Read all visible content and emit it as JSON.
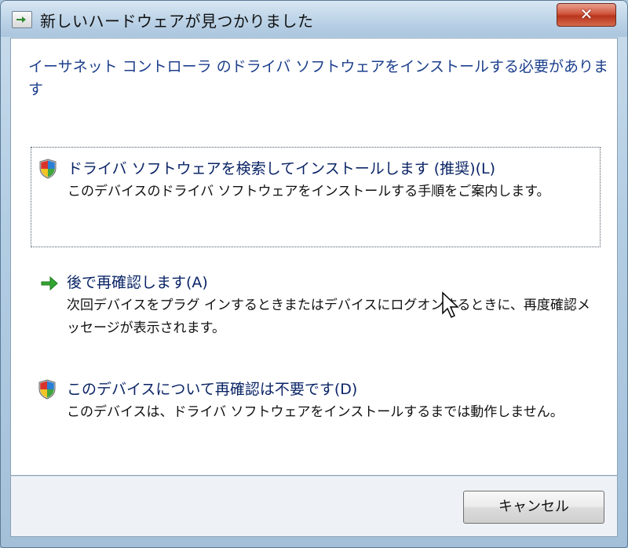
{
  "window": {
    "title": "新しいハードウェアが見つかりました",
    "close_label": "✕"
  },
  "header": {
    "text": "イーサネット コントローラ のドライバ ソフトウェアをインストールする必要があります"
  },
  "options": [
    {
      "title": "ドライバ ソフトウェアを検索してインストールします (推奨)(L)",
      "description": "このデバイスのドライバ ソフトウェアをインストールする手順をご案内します。",
      "icon": "shield-icon"
    },
    {
      "title": "後で再確認します(A)",
      "description": "次回デバイスをプラグ インするときまたはデバイスにログオンするときに、再度確認メッセージが表示されます。",
      "icon": "green-arrow-icon"
    },
    {
      "title": "このデバイスについて再確認は不要です(D)",
      "description": "このデバイスは、ドライバ ソフトウェアをインストールするまでは動作しません。",
      "icon": "shield-icon"
    }
  ],
  "footer": {
    "cancel_label": "キャンセル"
  },
  "colors": {
    "header_text": "#1c3f8c",
    "option_title": "#0a2466",
    "close_button": "#c8442a"
  }
}
